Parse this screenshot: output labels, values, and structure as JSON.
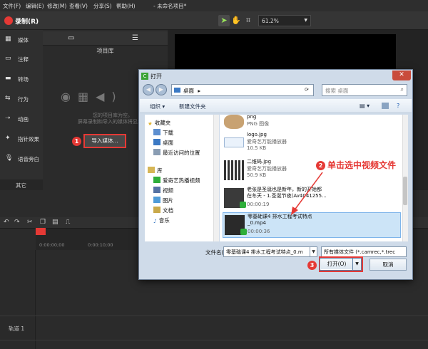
{
  "app": {
    "title": "- 未命名项目*",
    "menu": [
      "文件(F)",
      "编辑(E)",
      "修改(M)",
      "查看(V)",
      "分享(S)",
      "帮助(H)"
    ],
    "record_label": "录制(R)",
    "zoom": "61.2%"
  },
  "sidebar": {
    "items": [
      {
        "label": "媒体",
        "icon": "media-bin-icon"
      },
      {
        "label": "注释",
        "icon": "annotation-icon"
      },
      {
        "label": "转场",
        "icon": "transition-icon"
      },
      {
        "label": "行为",
        "icon": "behavior-icon"
      },
      {
        "label": "动画",
        "icon": "animation-icon"
      },
      {
        "label": "指针效果",
        "icon": "cursor-effect-icon"
      },
      {
        "label": "语音旁白",
        "icon": "microphone-icon"
      }
    ],
    "other_label": "其它"
  },
  "library": {
    "title": "项目库",
    "message_line1": "您的项目库为空。",
    "message_line2": "屏幕录制和导入的媒体将显示在",
    "import_button": "导入媒体..."
  },
  "timeline": {
    "times": [
      "0:00:00;00",
      "0:00:10;00"
    ],
    "track_label": "轨道 1"
  },
  "dialog": {
    "title": "打开",
    "address": "桌面",
    "search_placeholder": "搜索 桌面",
    "organize": "组织",
    "new_folder": "新建文件夹",
    "nav": [
      {
        "label": "收藏夹",
        "group": true
      },
      {
        "label": "下载"
      },
      {
        "label": "桌面"
      },
      {
        "label": "最近访问的位置"
      },
      {
        "label": "库",
        "group": true
      },
      {
        "label": "爱奇艺热播视频"
      },
      {
        "label": "视频"
      },
      {
        "label": "图片"
      },
      {
        "label": "文档"
      },
      {
        "label": "音乐"
      }
    ],
    "files": [
      {
        "name": "png",
        "sub1": "PNG 图像",
        "sub2": ""
      },
      {
        "name": "logo.jpg",
        "sub1": "爱奇艺万能播放器",
        "sub2": "10.5 KB"
      },
      {
        "name": "二维码.jpg",
        "sub1": "爱奇艺万能播放器",
        "sub2": "50.9 KB"
      },
      {
        "name": "老张是圣诞也是新年，新的开始都",
        "name2": "在冬天 - 1.圣诞节夜(Av4041255...",
        "sub1": "00:00:19",
        "sub2": ""
      },
      {
        "name": "零基础课4 排水工程考试特点",
        "name2": "_0.mp4",
        "sub1": "00:00:36",
        "sub2": ""
      }
    ],
    "filename_label": "文件名(N):",
    "filename_value": "零基础课4 排水工程考试特点_0.m",
    "filetype": "所有媒体文件 (*.camrec,*.trec",
    "open_button": "打开(O)",
    "cancel_button": "取消"
  },
  "annotations": {
    "step1": "1",
    "step2": "2",
    "step2_text": "单击选中视频文件",
    "step3": "3"
  },
  "colors": {
    "accent": "#e53935",
    "dialog_frame": "#cfdbe9",
    "selection": "#cce4f7"
  }
}
